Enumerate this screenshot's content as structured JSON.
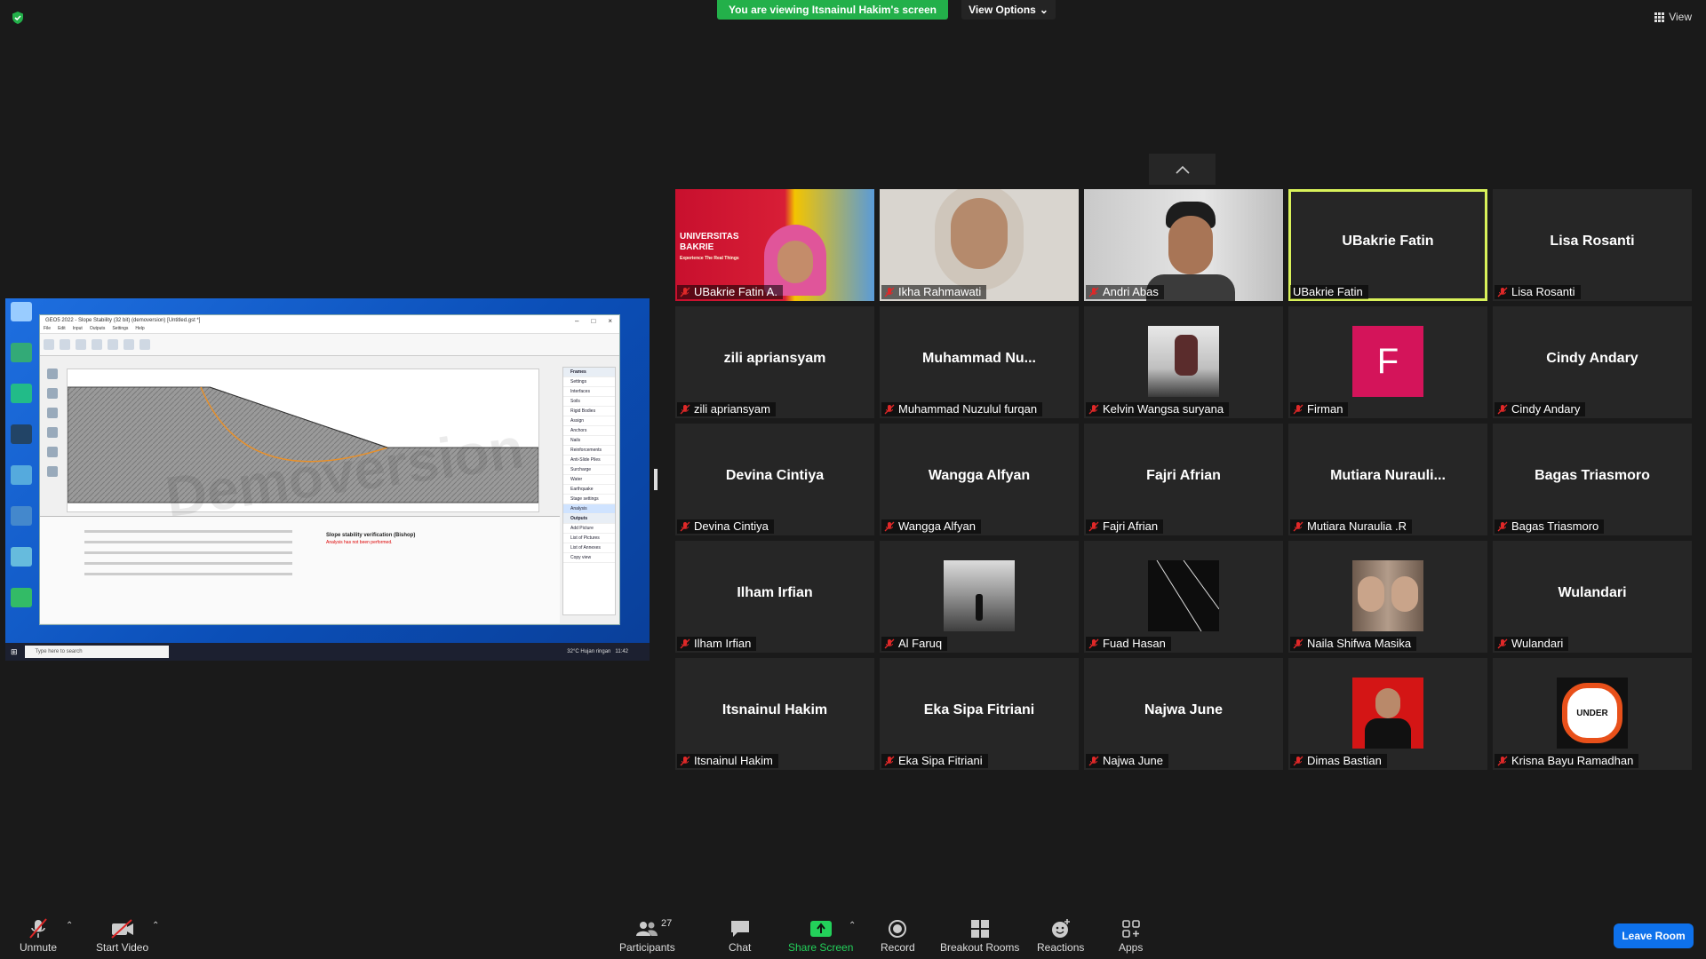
{
  "header": {
    "banner_text": "You are viewing Itsnainul Hakim's screen",
    "view_options_label": "View Options",
    "view_label": "View"
  },
  "shared_screen": {
    "window_title": "GEO5 2022 - Slope Stability (32 bit) (demoversion) [Untitled.gst *]",
    "menu": [
      "File",
      "Edit",
      "Input",
      "Outputs",
      "Settings",
      "Help"
    ],
    "frames_header": "Frames",
    "frames": [
      "Settings",
      "Interfaces",
      "Soils",
      "Rigid Bodies",
      "Assign",
      "Anchors",
      "Nails",
      "Reinforcements",
      "Anti-Slide Piles",
      "Surcharge",
      "Water",
      "Earthquake",
      "Stage settings",
      "Analysis"
    ],
    "outputs_header": "Outputs",
    "outputs": [
      "Add Picture",
      "List of Pictures",
      "List of Annexes",
      "Copy view"
    ],
    "analysis_title": "Slope stability verification (Bishop)",
    "analysis_note": "Analysis has not been performed.",
    "watermark": "Demoversion",
    "search_placeholder": "Type here to search",
    "tray_text": "32°C Hujan ringan",
    "clock": "11:42"
  },
  "participants": [
    {
      "display": "",
      "name": "UBakrie Fatin A.",
      "muted": true,
      "video": "banner"
    },
    {
      "display": "",
      "name": "Ikha Rahmawati",
      "muted": true,
      "video": "face-hijab"
    },
    {
      "display": "",
      "name": "Andri Abas",
      "muted": true,
      "video": "face-man"
    },
    {
      "display": "UBakrie Fatin",
      "name": "UBakrie Fatin",
      "muted": false,
      "video": "none",
      "active": true
    },
    {
      "display": "Lisa Rosanti",
      "name": "Lisa Rosanti",
      "muted": true,
      "video": "none"
    },
    {
      "display": "zili apriansyam",
      "name": "zili apriansyam",
      "muted": true,
      "video": "none"
    },
    {
      "display": "Muhammad  Nu...",
      "name": "Muhammad Nuzulul furqan",
      "muted": true,
      "video": "none"
    },
    {
      "display": "",
      "name": "Kelvin Wangsa suryana",
      "muted": true,
      "video": "avatar-photo"
    },
    {
      "display": "F",
      "name": "Firman",
      "muted": true,
      "video": "letter"
    },
    {
      "display": "Cindy Andary",
      "name": "Cindy Andary",
      "muted": true,
      "video": "none"
    },
    {
      "display": "Devina Cintiya",
      "name": "Devina Cintiya",
      "muted": true,
      "video": "none"
    },
    {
      "display": "Wangga Alfyan",
      "name": "Wangga Alfyan",
      "muted": true,
      "video": "none"
    },
    {
      "display": "Fajri Afrian",
      "name": "Fajri Afrian",
      "muted": true,
      "video": "none"
    },
    {
      "display": "Mutiara  Nurauli...",
      "name": "Mutiara Nuraulia .R",
      "muted": true,
      "video": "none"
    },
    {
      "display": "Bagas Triasmoro",
      "name": "Bagas Triasmoro",
      "muted": true,
      "video": "none"
    },
    {
      "display": "Ilham Irfian",
      "name": "Ilham Irfian",
      "muted": true,
      "video": "none"
    },
    {
      "display": "",
      "name": "Al Faruq",
      "muted": true,
      "video": "avatar-sea"
    },
    {
      "display": "",
      "name": "Fuad Hasan",
      "muted": true,
      "video": "avatar-marble"
    },
    {
      "display": "",
      "name": "Naila Shifwa Masika",
      "muted": true,
      "video": "avatar-faces"
    },
    {
      "display": "Wulandari",
      "name": "Wulandari",
      "muted": true,
      "video": "none"
    },
    {
      "display": "Itsnainul Hakim",
      "name": "Itsnainul Hakim",
      "muted": true,
      "video": "none"
    },
    {
      "display": "Eka Sipa Fitriani",
      "name": "Eka Sipa Fitriani",
      "muted": true,
      "video": "none"
    },
    {
      "display": "Najwa June",
      "name": "Najwa June",
      "muted": true,
      "video": "none"
    },
    {
      "display": "",
      "name": "Dimas Bastian",
      "muted": true,
      "video": "avatar-portrait"
    },
    {
      "display": "",
      "name": "Krisna Bayu Ramadhan",
      "muted": true,
      "video": "avatar-badge"
    }
  ],
  "tile_labels": {
    "banner_line1": "UNIVERSITAS",
    "banner_line2": "BAKRIE",
    "banner_tag": "Experience The Real Things",
    "badge_text": "UNDER"
  },
  "toolbar": {
    "unmute": "Unmute",
    "start_video": "Start Video",
    "participants": "Participants",
    "participants_count": "27",
    "chat": "Chat",
    "share_screen": "Share Screen",
    "record": "Record",
    "breakout_rooms": "Breakout Rooms",
    "reactions": "Reactions",
    "apps": "Apps",
    "leave_room": "Leave Room"
  },
  "colors": {
    "banner_green": "#23b04a",
    "active_speaker": "#d9f25a",
    "muted_red": "#e02828",
    "leave_blue": "#0e71eb",
    "letter_avatar": "#d4145a"
  }
}
